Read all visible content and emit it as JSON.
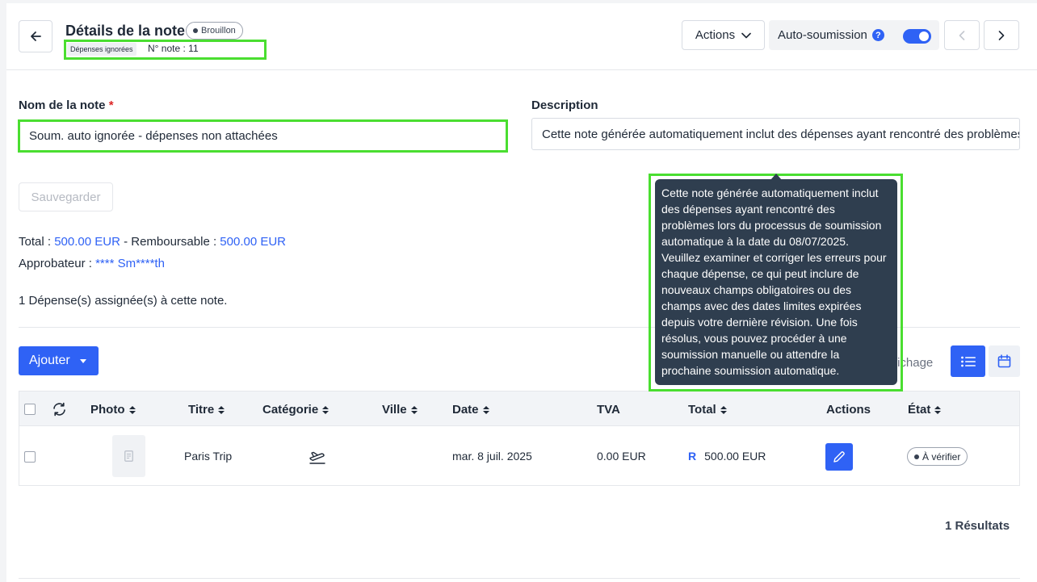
{
  "header": {
    "title": "Détails de la note",
    "status_badge": "Brouillon",
    "ignored_tag": "Dépenses ignorées",
    "note_number": "N° note : 11",
    "actions_label": "Actions",
    "auto_submit_label": "Auto-soumission",
    "auto_submit_help": "?",
    "auto_submit_enabled": true
  },
  "form": {
    "name_label": "Nom de la note",
    "required_mark": "*",
    "name_value": "Soum. auto ignorée - dépenses non attachées",
    "description_label": "Description",
    "description_value": "Cette note générée automatiquement inclut des dépenses ayant rencontré des problèmes lors du processus de soumission automatique à la date du 08/07/2025.",
    "save_label": "Sauvegarder"
  },
  "summary": {
    "total_label": "Total : ",
    "total_value": "500.00 EUR",
    "refundable_label": " - Remboursable : ",
    "refundable_value": "500.00 EUR",
    "approver_label": "Approbateur : ",
    "approver_value": "**** Sm****th",
    "assigned_text": "1 Dépense(s) assignée(s) à cette note."
  },
  "toolbar": {
    "add_label": "Ajouter",
    "view_label": "ffichage"
  },
  "table": {
    "headers": {
      "photo": "Photo",
      "title": "Titre",
      "category": "Catégorie",
      "city": "Ville",
      "date": "Date",
      "vat": "TVA",
      "total": "Total",
      "actions": "Actions",
      "state": "État"
    },
    "rows": [
      {
        "title": "Paris Trip",
        "category_icon": "plane-departure-icon",
        "city": "",
        "date": "mar. 8 juil. 2025",
        "vat": "0.00 EUR",
        "refund_mark": "R",
        "total": "500.00 EUR",
        "state": "À vérifier"
      }
    ]
  },
  "results_text": "1 Résultats",
  "tooltip": {
    "text": "Cette note générée automatiquement inclut des dépenses ayant rencontré des problèmes lors du processus de soumission automatique à la date du 08/07/2025. Veuillez examiner et corriger les erreurs pour chaque dépense, ce qui peut inclure de nouveaux champs obligatoires ou des champs avec des dates limites expirées depuis votre dernière révision. Une fois résolus, vous pouvez procéder à une soumission manuelle ou attendre la prochaine soumission automatique."
  },
  "colors": {
    "primary": "#2f62f5",
    "tooltip_bg": "#2f3e4f",
    "highlight": "#4ade30",
    "required": "#dc2626"
  }
}
